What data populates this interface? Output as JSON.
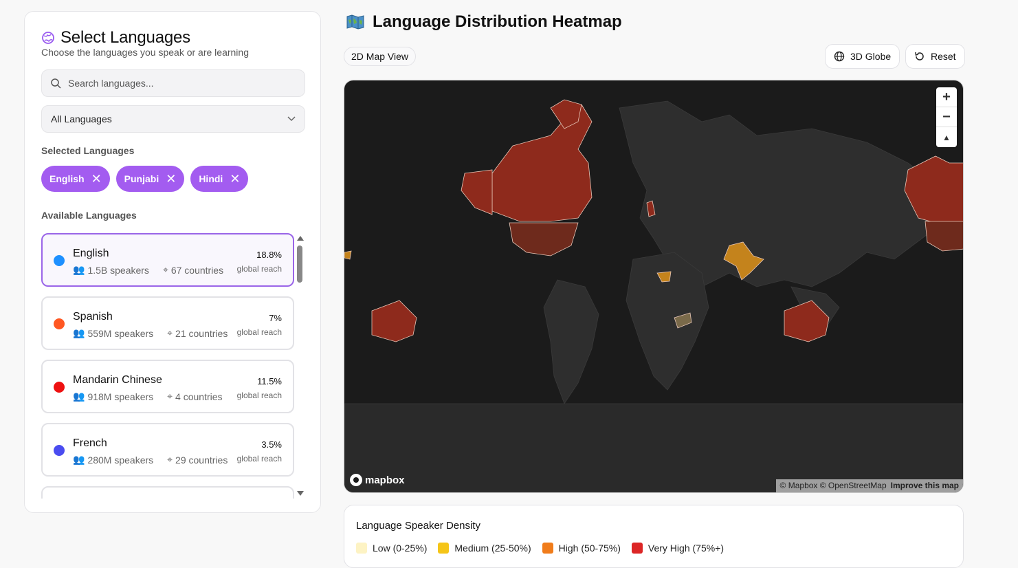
{
  "sidebar": {
    "title": "Select Languages",
    "subtitle": "Choose the languages you speak or are learning",
    "search_placeholder": "Search languages...",
    "filter_value": "All Languages",
    "selected_label": "Selected Languages",
    "selected": [
      {
        "label": "English"
      },
      {
        "label": "Punjabi"
      },
      {
        "label": "Hindi"
      }
    ],
    "available_label": "Available Languages",
    "languages": [
      {
        "name": "English",
        "speakers": "1.5B speakers",
        "countries": "67 countries",
        "pct": "18.8%",
        "reach": "global reach",
        "color": "#1e90ff"
      },
      {
        "name": "Spanish",
        "speakers": "559M speakers",
        "countries": "21 countries",
        "pct": "7%",
        "reach": "global reach",
        "color": "#ff5722"
      },
      {
        "name": "Mandarin Chinese",
        "speakers": "918M speakers",
        "countries": "4 countries",
        "pct": "11.5%",
        "reach": "global reach",
        "color": "#ee1111"
      },
      {
        "name": "French",
        "speakers": "280M speakers",
        "countries": "29 countries",
        "pct": "3.5%",
        "reach": "global reach",
        "color": "#4a4cf0"
      }
    ]
  },
  "main": {
    "title": "Language Distribution Heatmap",
    "view_label": "2D Map View",
    "globe_label": "3D Globe",
    "reset_label": "Reset",
    "map": {
      "logo": "mapbox",
      "attribution": "© Mapbox © OpenStreetMap",
      "improve": "Improve this map",
      "zoom_in": "+",
      "zoom_out": "−",
      "compass": "▲"
    },
    "legend": {
      "title": "Language Speaker Density",
      "items": [
        {
          "label": "Low (0-25%)",
          "color": "#fdf3c4"
        },
        {
          "label": "Medium (25-50%)",
          "color": "#f5c518"
        },
        {
          "label": "High (50-75%)",
          "color": "#f07c1b"
        },
        {
          "label": "Very High (75%+)",
          "color": "#dc2626"
        }
      ]
    }
  }
}
